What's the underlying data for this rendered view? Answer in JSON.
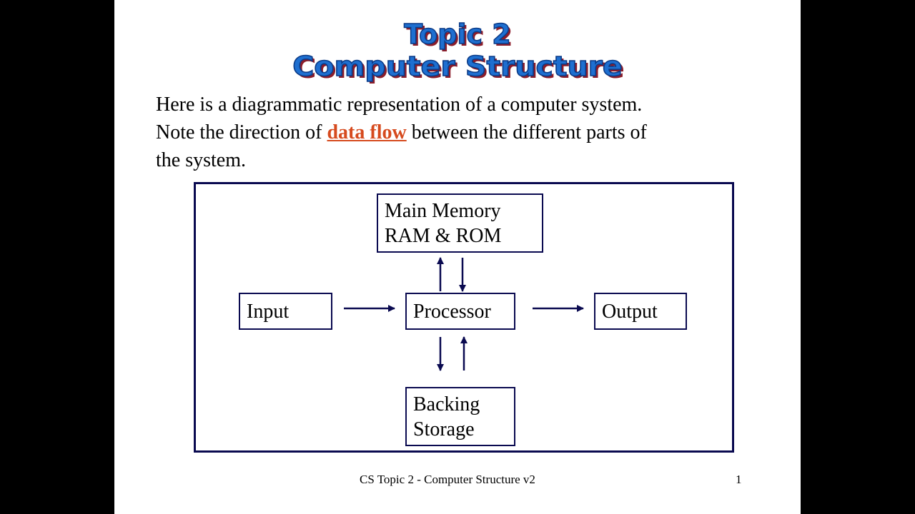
{
  "slide": {
    "title_line1": "Topic 2",
    "title_line2": "Computer Structure",
    "intro": {
      "part1": "Here is a diagrammatic representation of a computer system.  Note the direction of ",
      "highlight": "data flow",
      "part2": " between the different parts of the system."
    },
    "diagram": {
      "nodes": {
        "memory_line1": "Main Memory",
        "memory_line2": "RAM & ROM",
        "input": "Input",
        "processor": "Processor",
        "output": "Output",
        "storage_line1": "Backing",
        "storage_line2": "Storage"
      },
      "edges": [
        {
          "from": "Input",
          "to": "Processor"
        },
        {
          "from": "Processor",
          "to": "Output"
        },
        {
          "from": "Processor",
          "to": "Main Memory"
        },
        {
          "from": "Main Memory",
          "to": "Processor"
        },
        {
          "from": "Processor",
          "to": "Backing Storage"
        },
        {
          "from": "Backing Storage",
          "to": "Processor"
        }
      ]
    },
    "footer": {
      "text": "CS Topic 2 - Computer Structure v2",
      "page_number": "1"
    },
    "colors": {
      "title": "#1e6fd0",
      "highlight": "#d64a1e",
      "lines": "#0a0a50"
    }
  }
}
